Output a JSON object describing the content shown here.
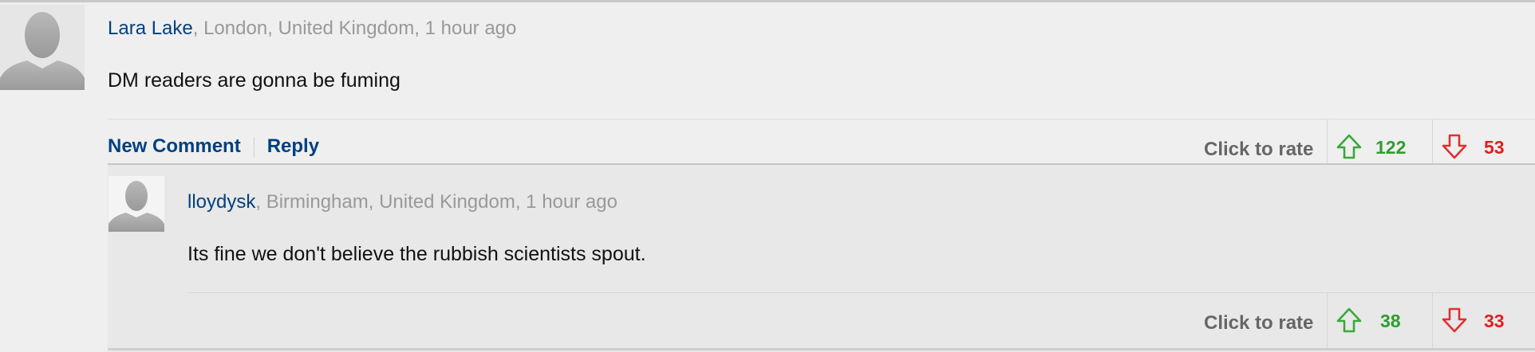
{
  "comments": [
    {
      "username": "Lara Lake",
      "location_time": ", London, United Kingdom, 1 hour ago",
      "text": "DM readers are gonna be fuming",
      "actions": {
        "new_comment": "New Comment",
        "reply": "Reply"
      },
      "rate_label": "Click to rate",
      "upvotes": "122",
      "downvotes": "53",
      "avatar_icon": "default-user-silhouette-icon"
    },
    {
      "username": "lloydysk",
      "location_time": ", Birmingham, United Kingdom, 1 hour ago",
      "text": "Its fine we don't believe the rubbish scientists spout.",
      "rate_label": "Click to rate",
      "upvotes": "38",
      "downvotes": "33",
      "avatar_icon": "default-user-silhouette-icon"
    }
  ],
  "colors": {
    "username": "#004080",
    "meta_gray": "#999999",
    "upvote_green": "#2e9e2e",
    "downvote_red": "#e02020",
    "page_bg": "#efefef",
    "reply_bg": "#e8e8e8"
  },
  "icons": {
    "upvote": "arrow-up-outline-icon",
    "downvote": "arrow-down-outline-icon"
  }
}
